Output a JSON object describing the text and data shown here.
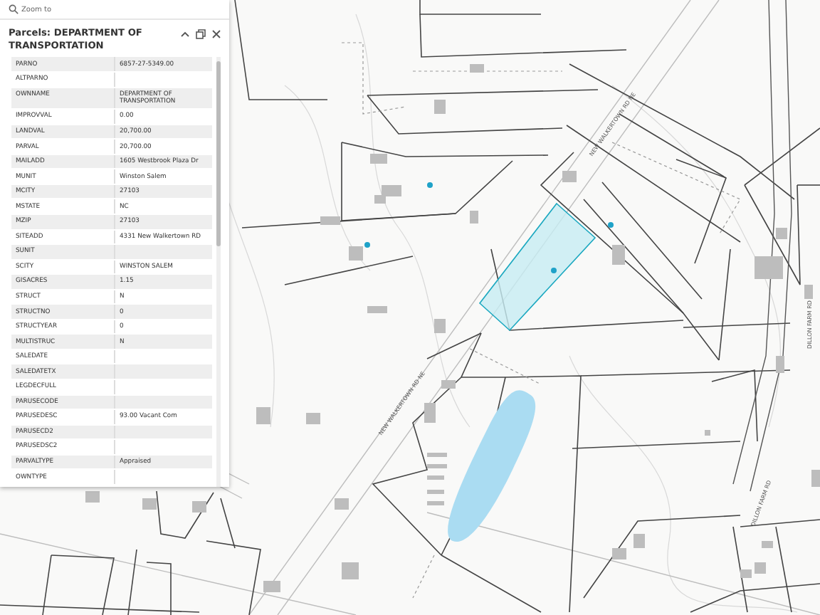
{
  "popup": {
    "zoom_label": "Zoom to",
    "title": "Parcels: DEPARTMENT OF TRANSPORTATION",
    "fields": [
      {
        "name": "PARNO",
        "value": "6857-27-5349.00"
      },
      {
        "name": "ALTPARNO"
      },
      {
        "name": "OWNNAME",
        "value": "DEPARTMENT OF TRANSPORTATION"
      },
      {
        "name": "IMPROVVAL",
        "value": "0.00"
      },
      {
        "name": "LANDVAL",
        "value": "20,700.00"
      },
      {
        "name": "PARVAL",
        "value": "20,700.00"
      },
      {
        "name": "MAILADD",
        "value": "1605 Westbrook Plaza Dr"
      },
      {
        "name": "MUNIT",
        "value": "Winston Salem"
      },
      {
        "name": "MCITY",
        "value": "27103"
      },
      {
        "name": "MSTATE",
        "value": "NC"
      },
      {
        "name": "MZIP",
        "value": "27103"
      },
      {
        "name": "SITEADD",
        "value": "4331 New Walkertown RD"
      },
      {
        "name": "SUNIT"
      },
      {
        "name": "SCITY",
        "value": "WINSTON SALEM"
      },
      {
        "name": "GISACRES",
        "value": "1.15"
      },
      {
        "name": "STRUCT",
        "value": "N"
      },
      {
        "name": "STRUCTNO",
        "value": "0"
      },
      {
        "name": "STRUCTYEAR",
        "value": "0"
      },
      {
        "name": "MULTISTRUC",
        "value": "N"
      },
      {
        "name": "SALEDATE"
      },
      {
        "name": "SALEDATETX"
      },
      {
        "name": "LEGDECFULL"
      },
      {
        "name": "PARUSECODE"
      },
      {
        "name": "PARUSEDESC",
        "value": "93.00 Vacant Com"
      },
      {
        "name": "PARUSECD2"
      },
      {
        "name": "PARUSEDSC2"
      },
      {
        "name": "PARVALTYPE",
        "value": "Appraised"
      },
      {
        "name": "OWNTYPE"
      }
    ]
  },
  "map": {
    "road_labels": [
      "NEW WALKERTOWN RD NE",
      "NEW WALKERTOWN RD NE",
      "DILLON FARM RD",
      "DILLON FARM RD"
    ]
  }
}
